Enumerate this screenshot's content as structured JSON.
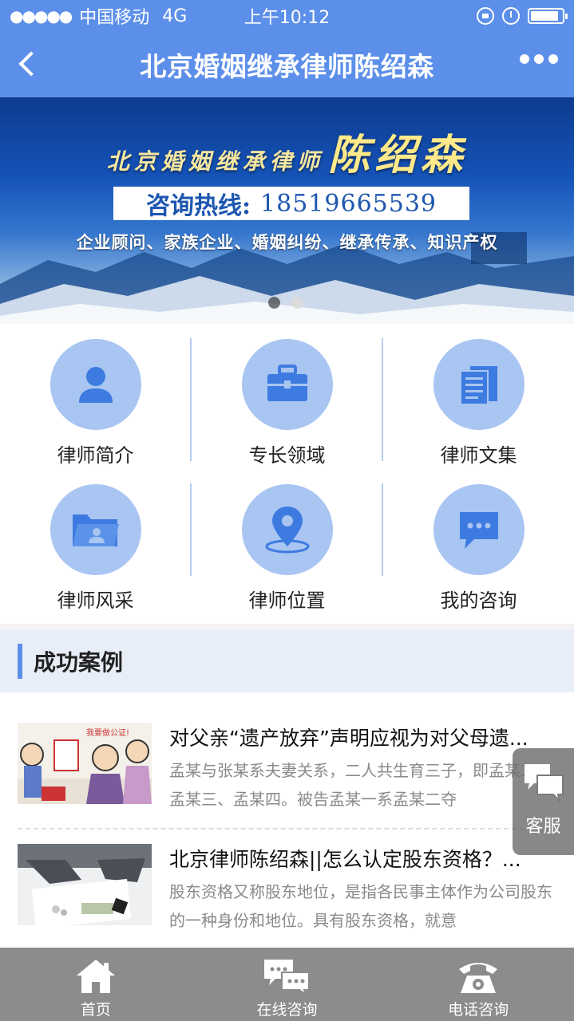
{
  "status_bar": {
    "carrier": "中国移动",
    "network": "4G",
    "time": "上午10:12",
    "battery_level": 0.9
  },
  "nav": {
    "title": "北京婚姻继承律师陈绍森",
    "back_icon": "chevron-left-icon",
    "more_icon": "more-dots-icon"
  },
  "banner": {
    "subtitle": "北京婚姻继承律师",
    "name": "陈绍森",
    "hotline_label": "咨询热线:",
    "hotline_number": "18519665539",
    "services": "企业顾问、家族企业、婚姻纠纷、继承传承、知识产权",
    "slide_count": 2,
    "active_slide": 2
  },
  "menu": [
    {
      "label": "律师简介",
      "icon": "person-icon"
    },
    {
      "label": "专长领域",
      "icon": "briefcase-icon"
    },
    {
      "label": "律师文集",
      "icon": "documents-icon"
    },
    {
      "label": "律师风采",
      "icon": "folder-profile-icon"
    },
    {
      "label": "律师位置",
      "icon": "location-pin-icon"
    },
    {
      "label": "我的咨询",
      "icon": "chat-bubble-icon"
    }
  ],
  "section": {
    "title": "成功案例"
  },
  "cases": [
    {
      "title": "对父亲“遗产放弃”声明应视为对父母遗...",
      "desc": "孟某与张某系夫妻关系，二人共生育三子，即孟某二、孟某三、孟某四。被告孟某一系孟某二夺"
    },
    {
      "title": "北京律师陈绍森||怎么认定股东资格？...",
      "desc": "股东资格又称股东地位，是指各民事主体作为公司股东的一种身份和地位。具有股东资格，就意"
    }
  ],
  "float_service": {
    "label": "客服",
    "icon": "chat-bubbles-icon"
  },
  "tabbar": [
    {
      "label": "首页",
      "icon": "home-icon"
    },
    {
      "label": "在线咨询",
      "icon": "chat-bubbles-icon"
    },
    {
      "label": "电话咨询",
      "icon": "telephone-icon"
    }
  ],
  "colors": {
    "primary": "#5c8fe9",
    "icon_circle": "#a9c5f2",
    "icon_glyph": "#3d7be0",
    "tabbar": "#8c8c8c",
    "section_bg": "#e8eef8"
  }
}
